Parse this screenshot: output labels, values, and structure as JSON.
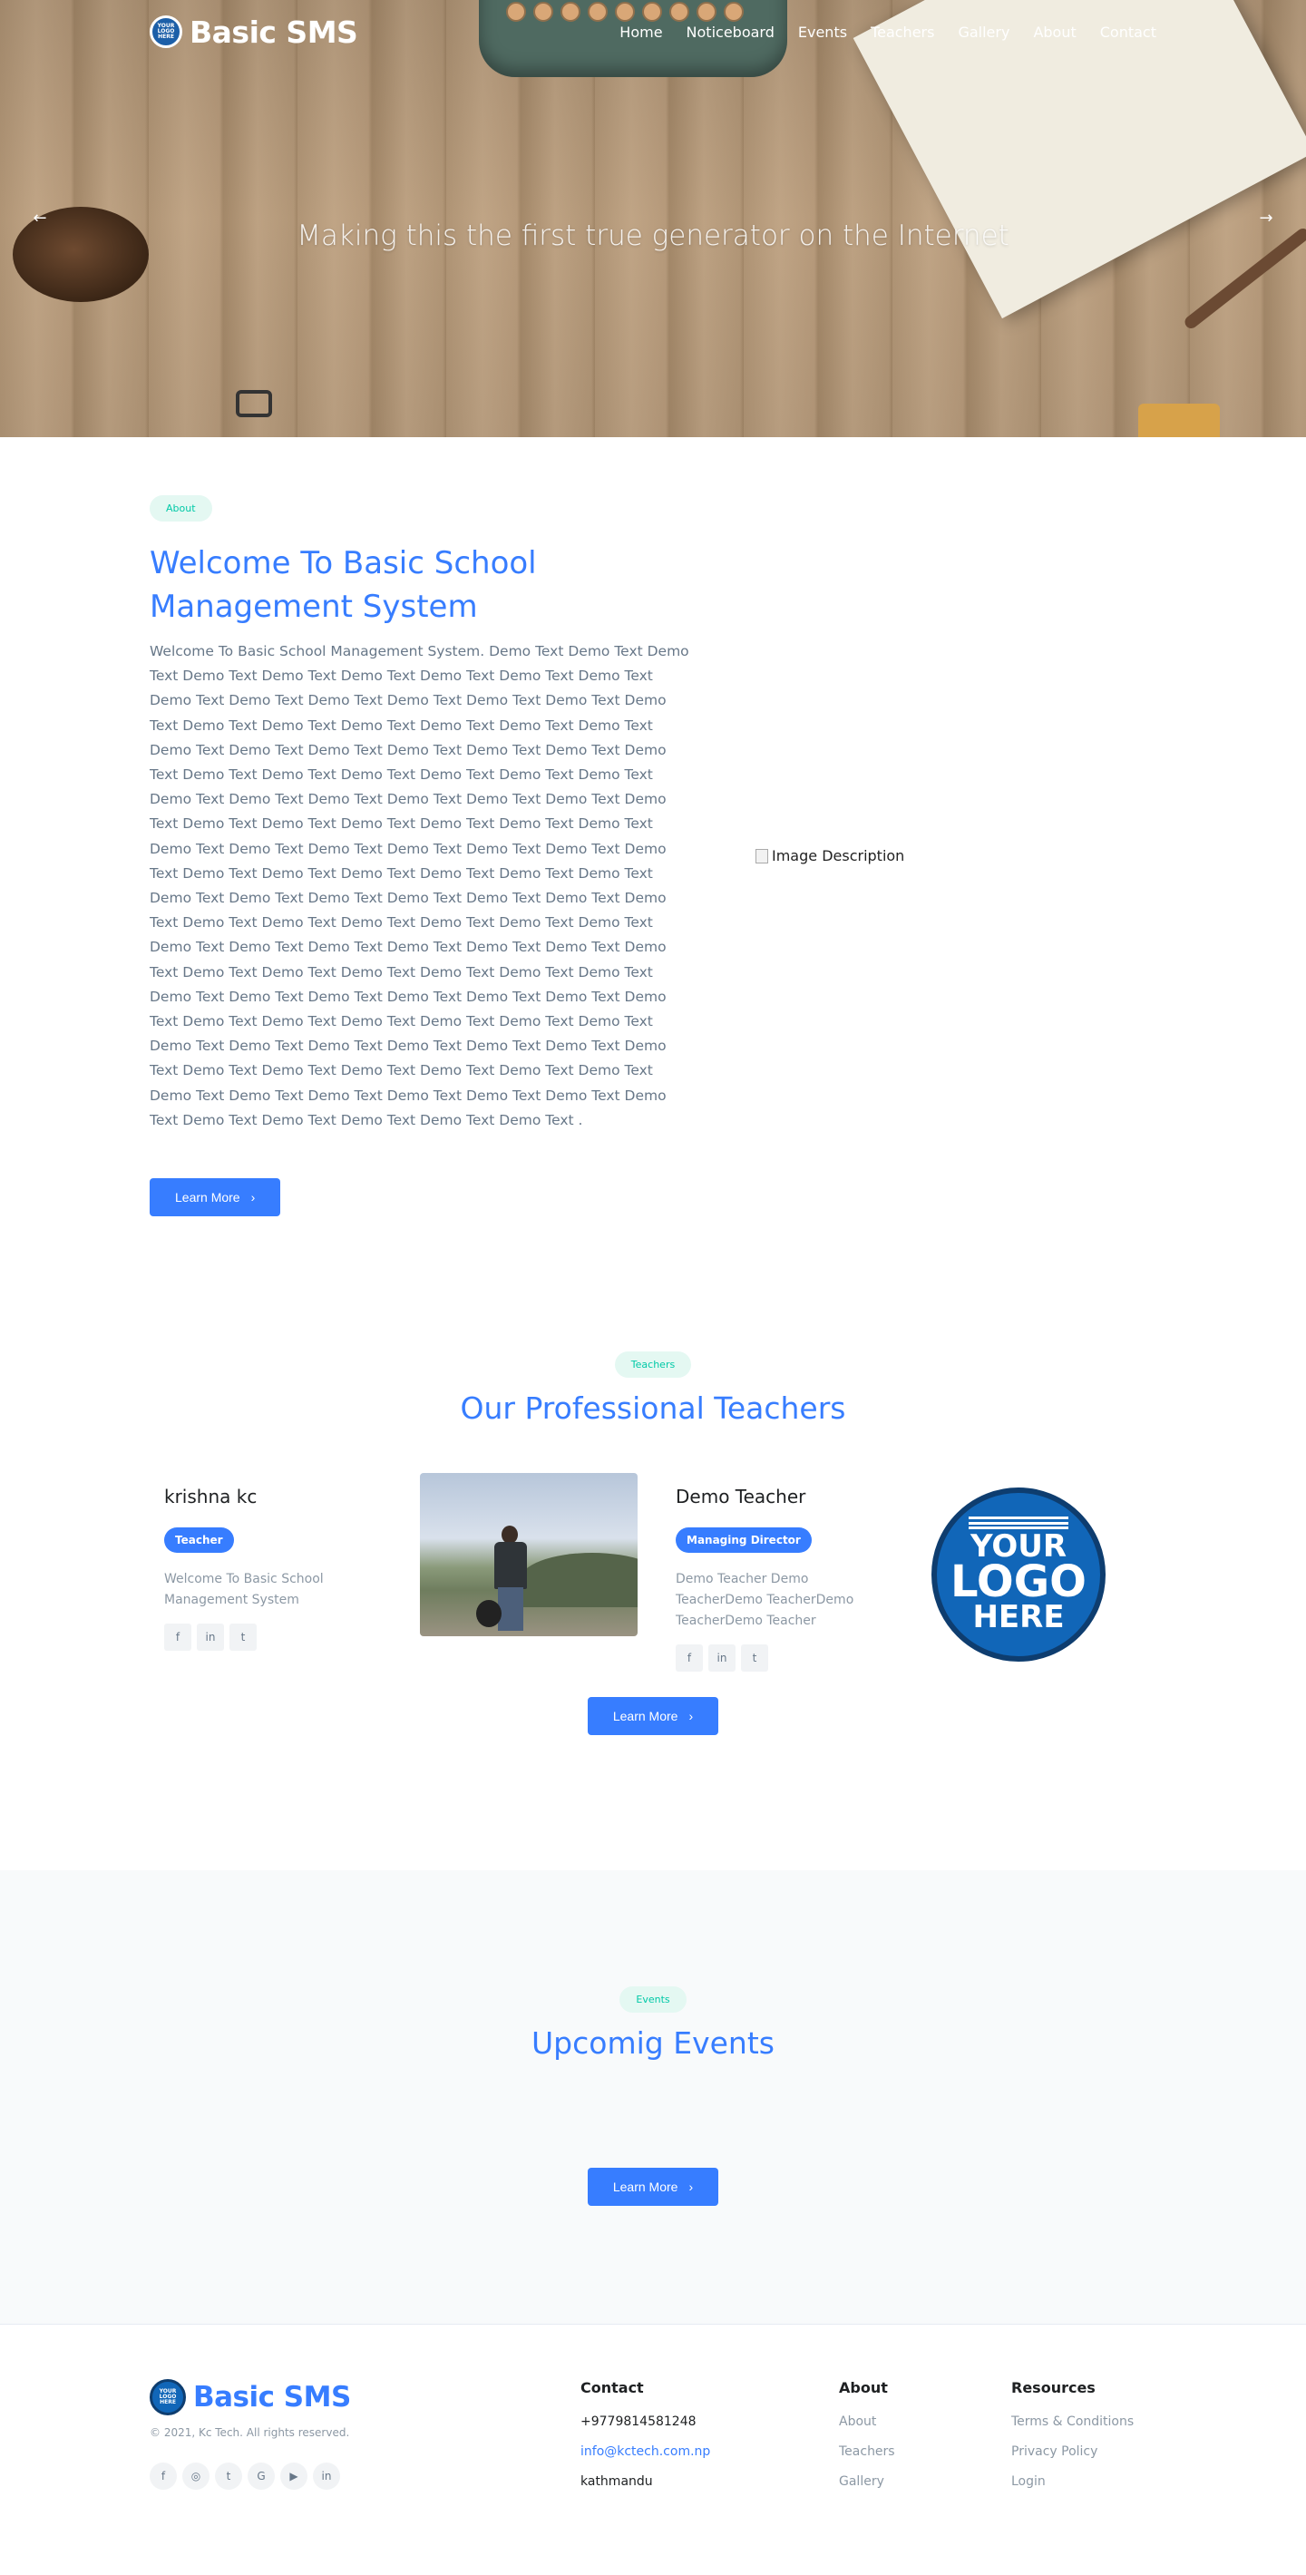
{
  "nav": {
    "brand_logo_text": "YOUR LOGO HERE",
    "brand_name": "Basic SMS",
    "links": [
      "Home",
      "Noticeboard",
      "Events",
      "Teachers",
      "Gallery",
      "About",
      "Contact"
    ]
  },
  "hero": {
    "caption": "Making this the first true generator on the Internet",
    "prev_arrow": "←",
    "next_arrow": "→"
  },
  "about": {
    "badge": "About",
    "title": "Welcome To Basic School Management System",
    "body": "Welcome To Basic School Management System. Demo Text Demo Text Demo Text Demo Text Demo Text Demo Text Demo Text Demo Text Demo Text Demo Text Demo Text Demo Text Demo Text Demo Text Demo Text Demo Text Demo Text Demo Text Demo Text Demo Text Demo Text Demo Text Demo Text Demo Text Demo Text Demo Text Demo Text Demo Text Demo Text Demo Text Demo Text Demo Text Demo Text Demo Text Demo Text Demo Text Demo Text Demo Text Demo Text Demo Text Demo Text Demo Text Demo Text Demo Text Demo Text Demo Text Demo Text Demo Text Demo Text Demo Text Demo Text Demo Text Demo Text Demo Text Demo Text Demo Text Demo Text Demo Text Demo Text Demo Text Demo Text Demo Text Demo Text Demo Text Demo Text Demo Text Demo Text Demo Text Demo Text Demo Text Demo Text Demo Text Demo Text Demo Text Demo Text Demo Text Demo Text Demo Text Demo Text Demo Text Demo Text Demo Text Demo Text Demo Text Demo Text Demo Text Demo Text Demo Text Demo Text Demo Text Demo Text Demo Text Demo Text Demo Text Demo Text Demo Text Demo Text Demo Text Demo Text Demo Text Demo Text Demo Text Demo Text Demo Text Demo Text Demo Text Demo Text Demo Text Demo Text Demo Text Demo Text Demo Text Demo Text Demo Text Demo Text Demo Text Demo Text Demo Text Demo Text Demo Text Demo Text Demo Text Demo Text Demo Text Demo Text .",
    "button": "Learn More",
    "image_alt": "Image Description"
  },
  "teachers": {
    "badge": "Teachers",
    "title": "Our Professional Teachers",
    "cards": [
      {
        "name": "krishna kc",
        "role": "Teacher",
        "bio": "Welcome To Basic School Management System"
      },
      {
        "name": "Demo Teacher",
        "role": "Managing Director",
        "bio": "Demo Teacher Demo TeacherDemo TeacherDemo TeacherDemo Teacher"
      }
    ],
    "logo_lines": [
      "YOUR",
      "LOGO",
      "HERE"
    ],
    "button": "Learn More"
  },
  "events": {
    "badge": "Events",
    "title": "Upcomig Events",
    "button": "Learn More"
  },
  "footer": {
    "brand_logo_text": "YOUR LOGO HERE",
    "brand_name": "Basic SMS",
    "copyright": "© 2021, Kc Tech. All rights reserved.",
    "contact": {
      "heading": "Contact",
      "phone": "+9779814581248",
      "email": "info@kctech.com.np",
      "address": "kathmandu"
    },
    "about": {
      "heading": "About",
      "links": [
        "About",
        "Teachers",
        "Gallery"
      ]
    },
    "resources": {
      "heading": "Resources",
      "links": [
        "Terms & Conditions",
        "Privacy Policy",
        "Login"
      ]
    }
  },
  "colors": {
    "primary": "#377dff",
    "accent_teal": "#00c9a7",
    "muted_text": "#677788"
  }
}
